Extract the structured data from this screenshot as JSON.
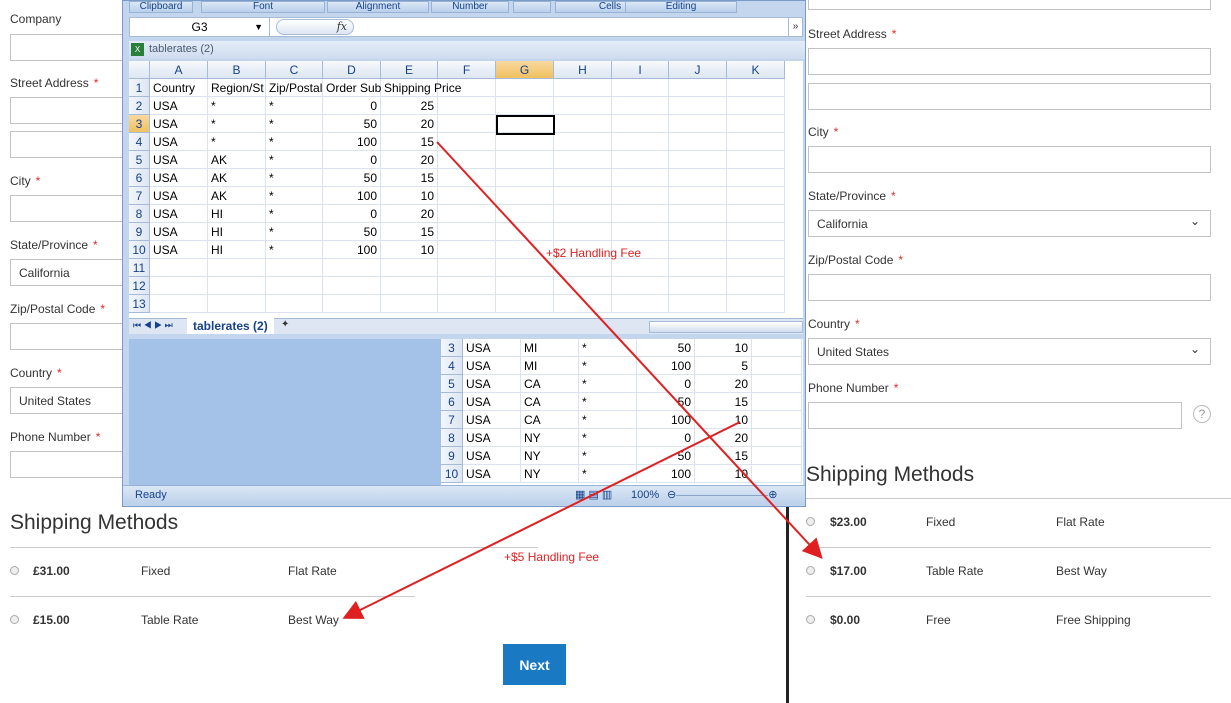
{
  "left_form": {
    "fields": [
      {
        "label": "Company",
        "required": false
      },
      {
        "label": "Street Address",
        "required": true
      },
      {
        "label": "City",
        "required": true
      },
      {
        "label": "State/Province",
        "required": true,
        "value": "California"
      },
      {
        "label": "Zip/Postal Code",
        "required": true
      },
      {
        "label": "Country",
        "required": true,
        "value": "United States"
      },
      {
        "label": "Phone Number",
        "required": true
      }
    ],
    "shipping_title": "Shipping Methods",
    "methods": [
      {
        "price": "£31.00",
        "type": "Fixed",
        "name": "Flat Rate"
      },
      {
        "price": "£15.00",
        "type": "Table Rate",
        "name": "Best Way"
      }
    ],
    "next_label": "Next"
  },
  "right_form": {
    "fields": [
      {
        "label": "Street Address"
      },
      {
        "label": "City"
      },
      {
        "label": "State/Province",
        "value": "California"
      },
      {
        "label": "Zip/Postal Code"
      },
      {
        "label": "Country",
        "value": "United States"
      },
      {
        "label": "Phone Number"
      }
    ],
    "required_mark": "*",
    "help_icon": "?",
    "shipping_title": "Shipping Methods",
    "methods": [
      {
        "price": "$23.00",
        "type": "Fixed",
        "name": "Flat Rate"
      },
      {
        "price": "$17.00",
        "type": "Table Rate",
        "name": "Best Way"
      },
      {
        "price": "$0.00",
        "type": "Free",
        "name": "Free Shipping"
      }
    ]
  },
  "excel": {
    "ribbon_groups": [
      "Clipboard",
      "Font",
      "Alignment",
      "Number",
      "",
      "Cells",
      "Editing"
    ],
    "name_box": "G3",
    "fx": "fx",
    "workbook_title": "tablerates (2)",
    "columns": [
      "A",
      "B",
      "C",
      "D",
      "E",
      "F",
      "G",
      "H",
      "I",
      "J",
      "K"
    ],
    "rows": [
      [
        "1",
        "Country",
        "Region/St",
        "Zip/Postal",
        "Order Sub",
        "Shipping Price"
      ],
      [
        "2",
        "USA",
        "*",
        "*",
        "0",
        "25"
      ],
      [
        "3",
        "USA",
        "*",
        "*",
        "50",
        "20"
      ],
      [
        "4",
        "USA",
        "*",
        "*",
        "100",
        "15"
      ],
      [
        "5",
        "USA",
        "AK",
        "*",
        "0",
        "20"
      ],
      [
        "6",
        "USA",
        "AK",
        "*",
        "50",
        "15"
      ],
      [
        "7",
        "USA",
        "AK",
        "*",
        "100",
        "10"
      ],
      [
        "8",
        "USA",
        "HI",
        "*",
        "0",
        "20"
      ],
      [
        "9",
        "USA",
        "HI",
        "*",
        "50",
        "15"
      ],
      [
        "10",
        "USA",
        "HI",
        "*",
        "100",
        "10"
      ],
      [
        "11"
      ],
      [
        "12"
      ],
      [
        "13"
      ]
    ],
    "sheet_tab": "tablerates (2)",
    "second_rows": [
      [
        "3",
        "USA",
        "MI",
        "*",
        "50",
        "10"
      ],
      [
        "4",
        "USA",
        "MI",
        "*",
        "100",
        "5"
      ],
      [
        "5",
        "USA",
        "CA",
        "*",
        "0",
        "20"
      ],
      [
        "6",
        "USA",
        "CA",
        "*",
        "50",
        "15"
      ],
      [
        "7",
        "USA",
        "CA",
        "*",
        "100",
        "10"
      ],
      [
        "8",
        "USA",
        "NY",
        "*",
        "0",
        "20"
      ],
      [
        "9",
        "USA",
        "NY",
        "*",
        "50",
        "15"
      ],
      [
        "10",
        "USA",
        "NY",
        "*",
        "100",
        "10"
      ]
    ],
    "status": "Ready",
    "zoom": "100%",
    "selected_cell": "G3"
  },
  "annotations": {
    "fee1": "+$2 Handling Fee",
    "fee2": "+$5 Handling Fee",
    "color": "#e02020"
  },
  "colors": {
    "button": "#1979c3",
    "excel_frame": "#c3d6ee"
  }
}
